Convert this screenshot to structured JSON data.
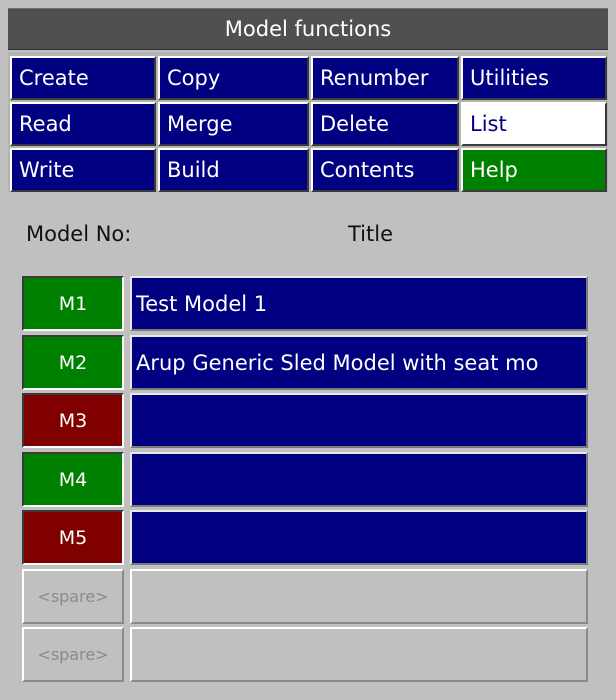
{
  "colors": {
    "navy": "#000080",
    "green": "#008000",
    "dark_red": "#800000",
    "white": "#ffffff",
    "title_bar": "#505050",
    "panel": "#c0c0c0"
  },
  "window": {
    "title": "Model functions"
  },
  "menu": {
    "rows": [
      [
        {
          "label": "Create",
          "state": "normal"
        },
        {
          "label": "Copy",
          "state": "normal"
        },
        {
          "label": "Renumber",
          "state": "normal"
        },
        {
          "label": "Utilities",
          "state": "normal"
        }
      ],
      [
        {
          "label": "Read",
          "state": "normal"
        },
        {
          "label": "Merge",
          "state": "normal"
        },
        {
          "label": "Delete",
          "state": "normal"
        },
        {
          "label": "List",
          "state": "selected"
        }
      ],
      [
        {
          "label": "Write",
          "state": "normal"
        },
        {
          "label": "Build",
          "state": "normal"
        },
        {
          "label": "Contents",
          "state": "normal"
        },
        {
          "label": "Help",
          "state": "help"
        }
      ]
    ]
  },
  "list": {
    "model_no_header": "Model No:",
    "title_header": "Title",
    "models": [
      {
        "id": "M1",
        "title": "Test Model 1",
        "status": "active"
      },
      {
        "id": "M2",
        "title": "Arup Generic Sled Model with seat mo",
        "status": "active"
      },
      {
        "id": "M3",
        "title": "",
        "status": "inactive"
      },
      {
        "id": "M4",
        "title": "",
        "status": "active"
      },
      {
        "id": "M5",
        "title": "",
        "status": "inactive"
      },
      {
        "id": "<spare>",
        "title": "",
        "status": "spare"
      },
      {
        "id": "<spare>",
        "title": "",
        "status": "spare"
      }
    ]
  }
}
